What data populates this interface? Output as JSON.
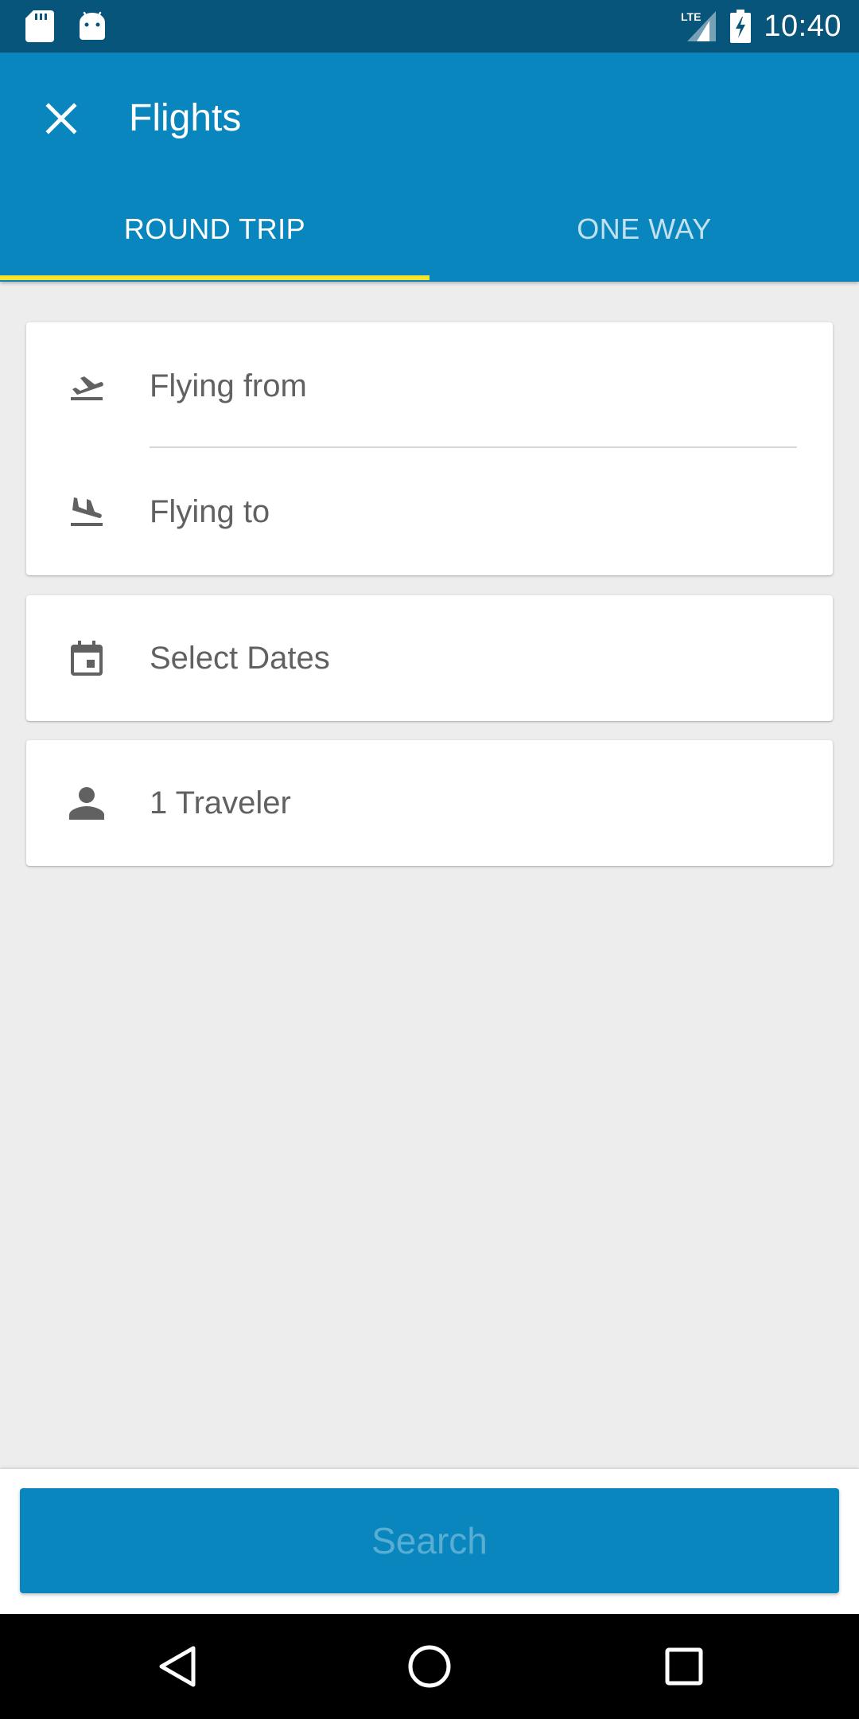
{
  "status_bar": {
    "time": "10:40",
    "network": "LTE",
    "icons": [
      "sd-card-icon",
      "android-icon",
      "lte-signal-icon",
      "battery-charging-icon"
    ]
  },
  "app_bar": {
    "title": "Flights",
    "close_icon": "close-icon",
    "background_color": "#0a86bf"
  },
  "tabs": [
    {
      "label": "ROUND TRIP",
      "selected": true
    },
    {
      "label": "ONE WAY",
      "selected": false
    }
  ],
  "tab_indicator_color": "#f6e42b",
  "form": {
    "flying_from": {
      "label": "Flying from",
      "icon": "flight-takeoff-icon"
    },
    "flying_to": {
      "label": "Flying to",
      "icon": "flight-land-icon"
    },
    "dates": {
      "label": "Select Dates",
      "icon": "calendar-icon"
    },
    "travelers": {
      "label": "1 Traveler",
      "icon": "person-icon"
    }
  },
  "search_button": {
    "label": "Search",
    "enabled": false
  },
  "nav_bar": {
    "icons": [
      "back-icon",
      "home-icon",
      "recents-icon"
    ]
  }
}
